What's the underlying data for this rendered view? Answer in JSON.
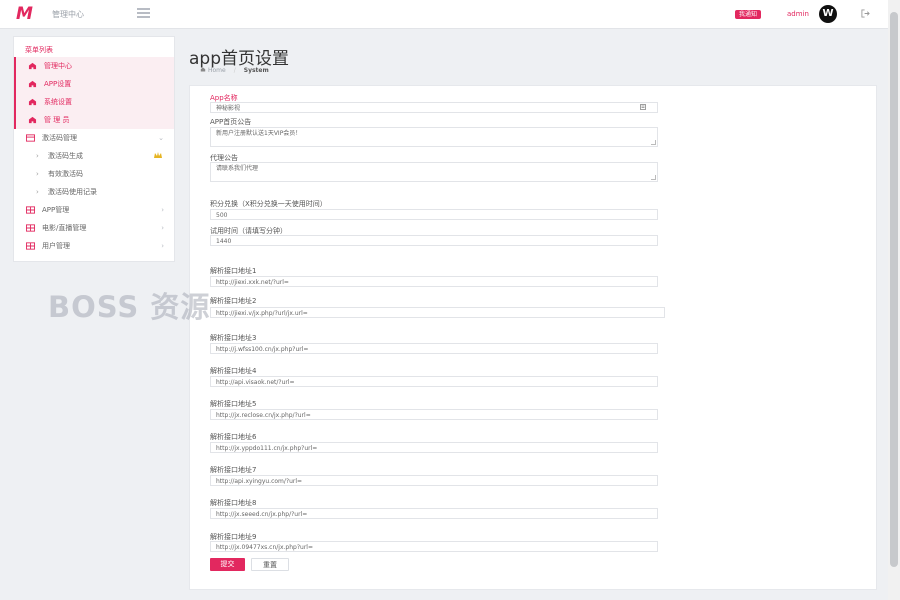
{
  "header": {
    "app_title": "管理中心",
    "notice_badge": "我通知",
    "username": "admin",
    "avatar_letter": "W",
    "accent_color": "#e2285f"
  },
  "sidebar": {
    "header": "菜单列表",
    "items": [
      {
        "label": "管理中心",
        "icon": "home-icon",
        "active": true
      },
      {
        "label": "APP设置",
        "icon": "home-icon",
        "active": true
      },
      {
        "label": "系统设置",
        "icon": "home-icon",
        "active": true
      },
      {
        "label": "管 理 员",
        "icon": "home-icon",
        "active": true
      },
      {
        "label": "激活码管理",
        "icon": "card-icon",
        "active": false,
        "arrow": "⌄"
      },
      {
        "label": "激活码生成",
        "sub": true,
        "crown": true
      },
      {
        "label": "有效激活码",
        "sub": true
      },
      {
        "label": "激活码使用记录",
        "sub": true
      },
      {
        "label": "APP管理",
        "icon": "grid-icon",
        "active": false,
        "arrow": "›"
      },
      {
        "label": "电影/直播管理",
        "icon": "grid-icon",
        "active": false,
        "arrow": "›"
      },
      {
        "label": "用户管理",
        "icon": "grid-icon",
        "active": false,
        "arrow": "›"
      }
    ]
  },
  "page": {
    "title": "app首页设置",
    "breadcrumb_home": "Home",
    "breadcrumb_current": "System"
  },
  "form": {
    "app_name_label": "App名称",
    "app_name_value": "神秘影视",
    "notice_label": "APP首页公告",
    "notice_value": "新用户注册默认送1天VIP会员！",
    "proxy_label": "代理公告",
    "proxy_value": "请联系我们代理",
    "points_label": "积分兑换（X积分兑换一天使用时间）",
    "points_value": "500",
    "trial_label": "试用时间（请填写分钟）",
    "trial_value": "1440",
    "parse_fields": [
      {
        "label": "解析接口地址1",
        "value": "http://jiexi.xxk.net/?url="
      },
      {
        "label": "解析接口地址2",
        "value": "http://jiexi.v/jx.php/?url/jx.url="
      },
      {
        "label": "解析接口地址3",
        "value": "http://j.wfss100.cn/jx.php?url="
      },
      {
        "label": "解析接口地址4",
        "value": "http://api.visaok.net/?url="
      },
      {
        "label": "解析接口地址5",
        "value": "http://jx.reclose.cn/jx.php/?url="
      },
      {
        "label": "解析接口地址6",
        "value": "http://jx.yppdo111.cn/jx.php?url="
      },
      {
        "label": "解析接口地址7",
        "value": "http://api.xyingyu.com/?url="
      },
      {
        "label": "解析接口地址8",
        "value": "http://jx.seeed.cn/jx.php/?url="
      },
      {
        "label": "解析接口地址9",
        "value": "http://jx.09477xs.cn/jx.php?url="
      }
    ],
    "submit_label": "提交",
    "reset_label": "重置"
  },
  "watermark": "BOSS 资源"
}
